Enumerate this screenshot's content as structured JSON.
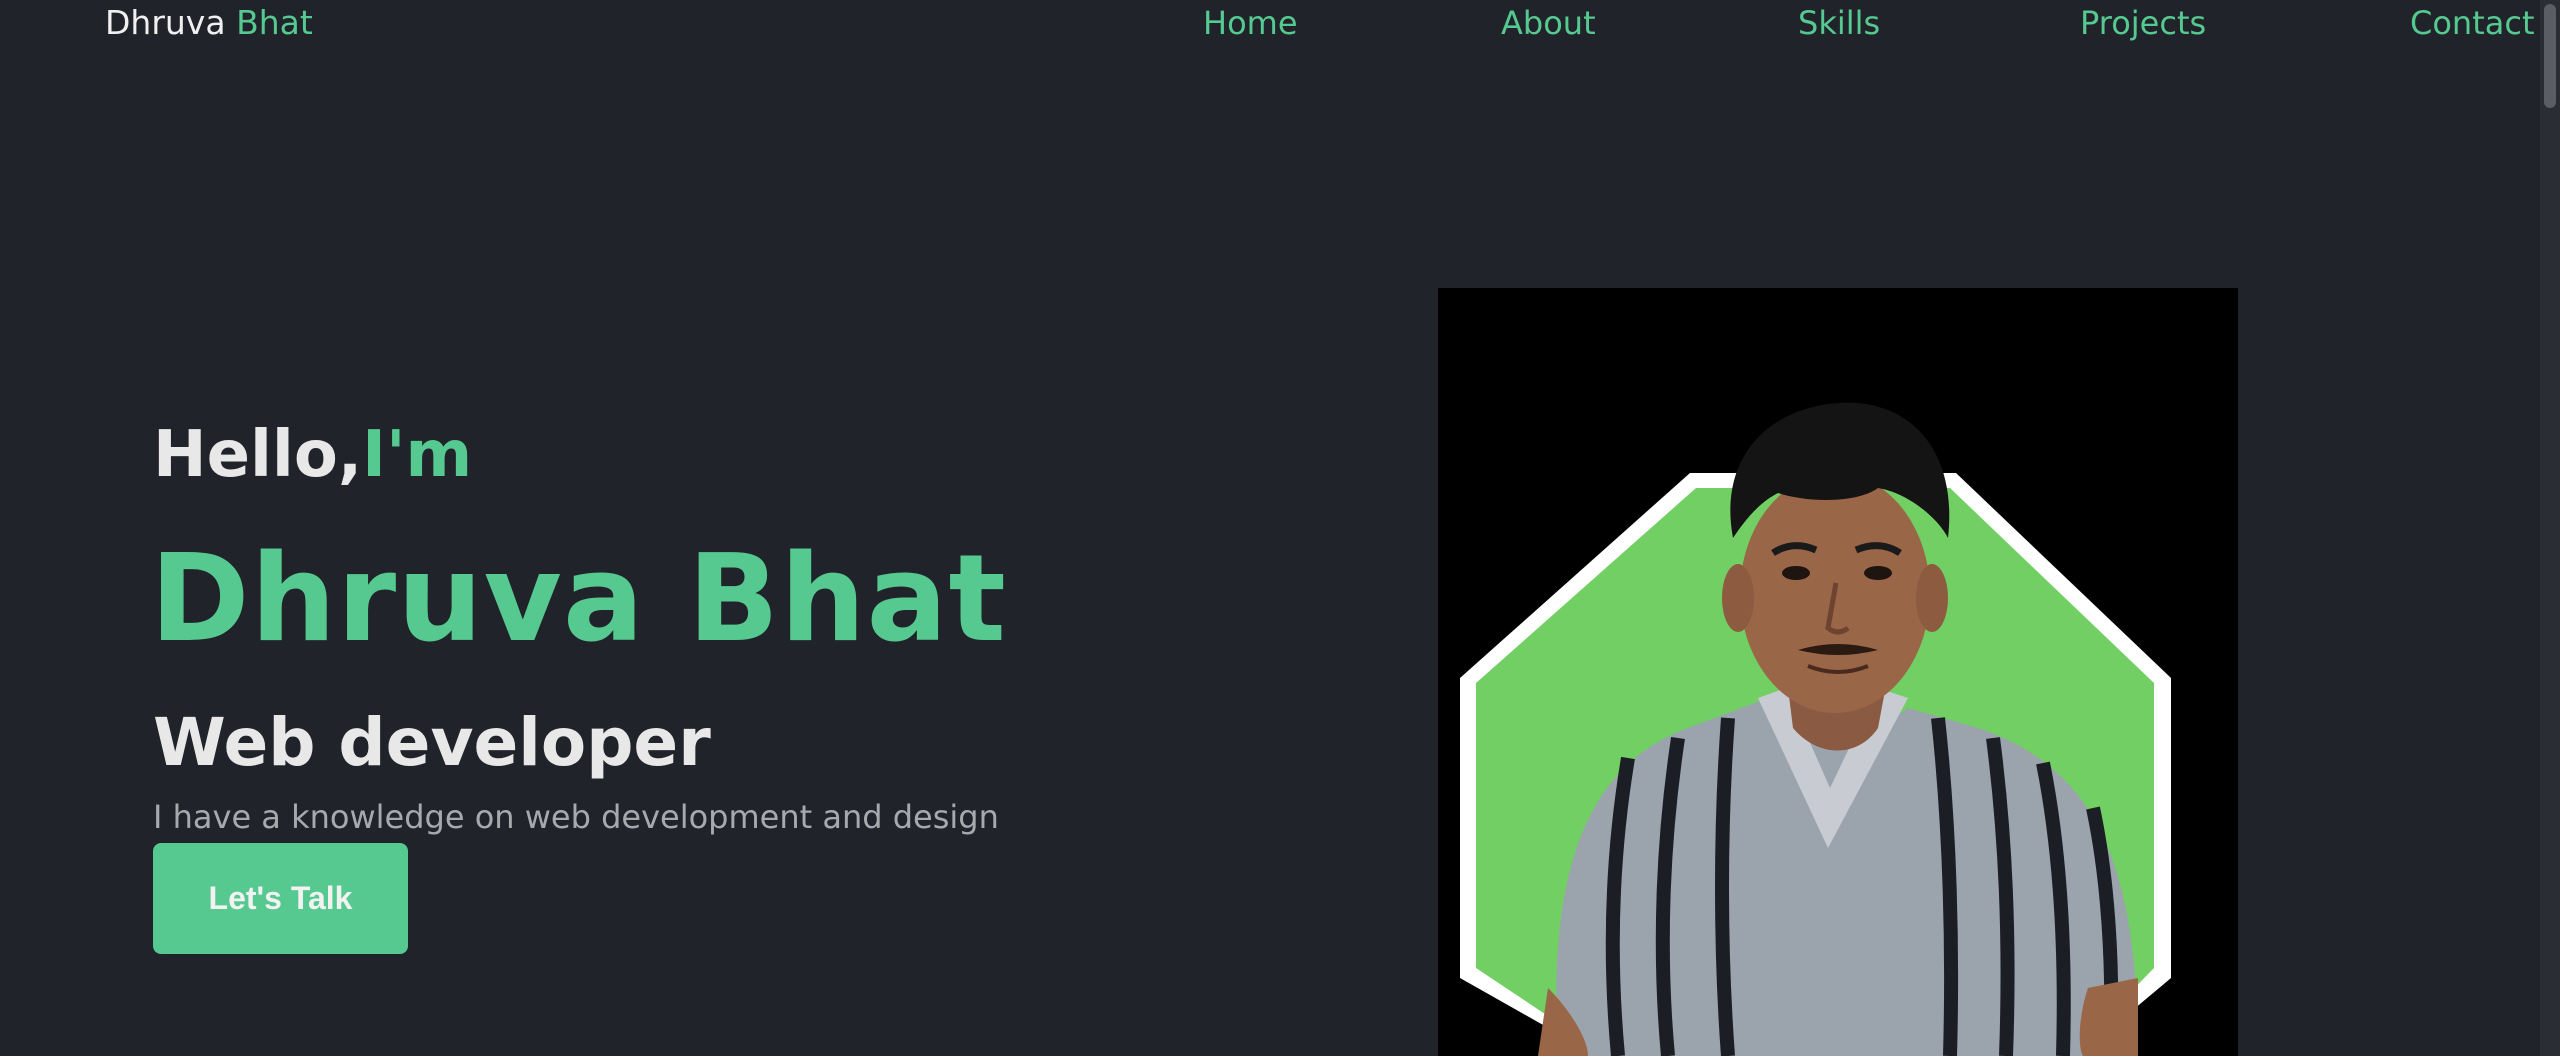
{
  "header": {
    "logo_first": "Dhruva",
    "logo_second": "Bhat",
    "nav": {
      "home": "Home",
      "about": "About",
      "skills": "Skills",
      "projects": "Projects",
      "contact": "Contact"
    }
  },
  "hero": {
    "greeting_hello": "Hello,",
    "greeting_im": "I'm",
    "name": "Dhruva Bhat",
    "role": "Web developer",
    "description": "I have a knowledge on web development and design",
    "cta_label": "Let's Talk"
  },
  "portrait": {
    "icon": "profile-photo-icon"
  },
  "colors": {
    "background": "#20232a",
    "accent": "#55c98f",
    "photo_bg": "#72cf64",
    "photo_frame": "#000000"
  }
}
